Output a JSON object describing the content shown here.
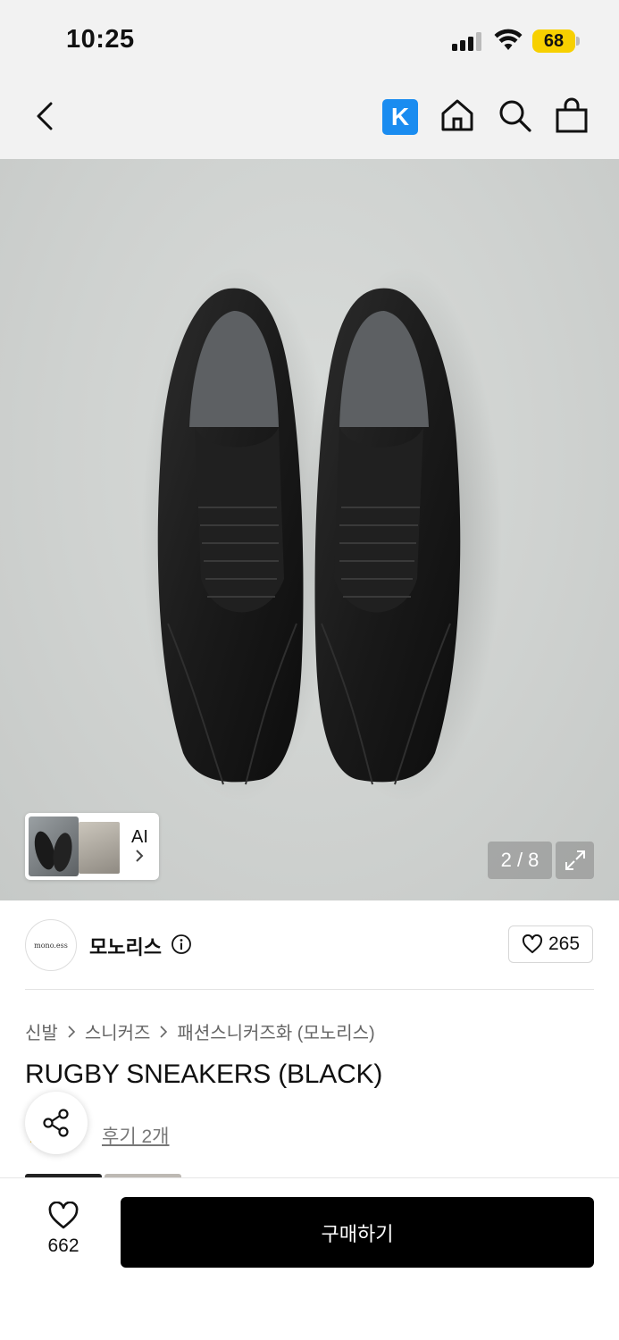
{
  "status_bar": {
    "time": "10:25",
    "battery": "68"
  },
  "nav": {
    "k_label": "K",
    "icons": [
      "back-icon",
      "kakao-k-icon",
      "home-icon",
      "search-icon",
      "shopping-bag-icon"
    ]
  },
  "gallery": {
    "ai_label": "AI",
    "counter": "2 / 8"
  },
  "brand": {
    "logo_text": "mono.ess",
    "name": "모노리스",
    "like_count": "265"
  },
  "breadcrumb": [
    "신발",
    "스니커즈",
    "패션스니커즈화 (모노리스)"
  ],
  "product": {
    "title": "RUGBY SNEAKERS (BLACK)",
    "review_link": "후기 2개"
  },
  "bottom_bar": {
    "wish_count": "662",
    "buy_label": "구매하기"
  },
  "colors": {
    "k_badge": "#1a8cf0",
    "battery": "#f7d000",
    "buy_button": "#000000"
  }
}
